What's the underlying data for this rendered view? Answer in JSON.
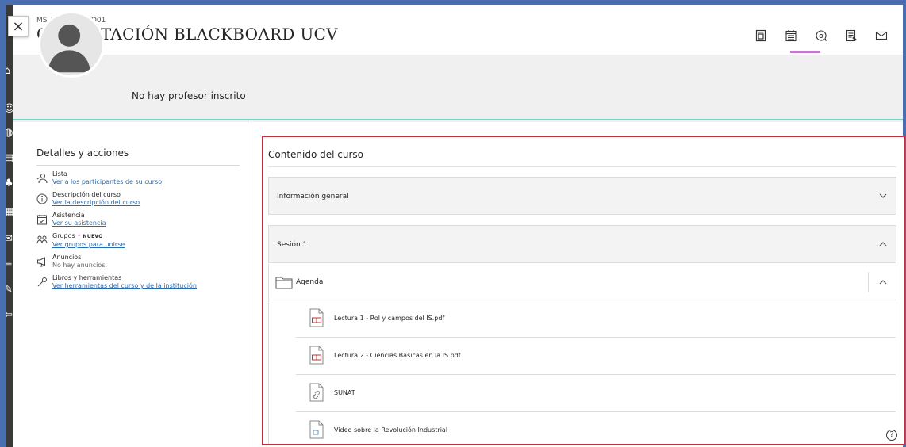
{
  "header": {
    "course_id": "MS_TAL_FD_TCID01",
    "course_title": "CAPACITACIÓN BLACKBOARD UCV",
    "close_label": "×",
    "tools": [
      {
        "name": "course-content-icon"
      },
      {
        "name": "calendar-icon"
      },
      {
        "name": "discussions-icon"
      },
      {
        "name": "gradebook-icon"
      },
      {
        "name": "messages-icon"
      }
    ],
    "active_tool_color": "#c678d0"
  },
  "banner": {
    "no_instructor_text": "No hay profesor inscrito",
    "accent_color": "#6fd6c9"
  },
  "details": {
    "title": "Detalles y acciones",
    "items": [
      {
        "icon": "roster-icon",
        "title": "Lista",
        "link": "Ver a los participantes de su curso"
      },
      {
        "icon": "info-icon",
        "title": "Descripción del curso",
        "link": "Ver la descripción del curso"
      },
      {
        "icon": "attendance-icon",
        "title": "Asistencia",
        "link": "Ver su asistencia"
      },
      {
        "icon": "groups-icon",
        "title": "Grupos",
        "badge": "NUEVO",
        "link": "Ver grupos para unirse"
      },
      {
        "icon": "announcements-icon",
        "title": "Anuncios",
        "static": "No hay anuncios."
      },
      {
        "icon": "tools-icon",
        "title": "Libros y herramientas",
        "link": "Ver herramientas del curso y de la institución"
      }
    ]
  },
  "content": {
    "title": "Contenido del curso",
    "outline_color": "#c0303a",
    "folders": [
      {
        "label": "Información general",
        "expanded": false
      },
      {
        "label": "Sesión 1",
        "expanded": true
      }
    ],
    "agenda": {
      "label": "Agenda",
      "expanded": true,
      "items": [
        {
          "label": "Lectura 1 - Rol y campos del IS.pdf",
          "icon": "pdf-file-icon"
        },
        {
          "label": "Lectura 2 - Ciencias Basicas en la IS.pdf",
          "icon": "pdf-file-icon"
        },
        {
          "label": "SUNAT",
          "icon": "link-file-icon"
        },
        {
          "label": "Video sobre la Revolución Industrial",
          "icon": "video-file-icon"
        }
      ]
    }
  },
  "help_label": "?"
}
